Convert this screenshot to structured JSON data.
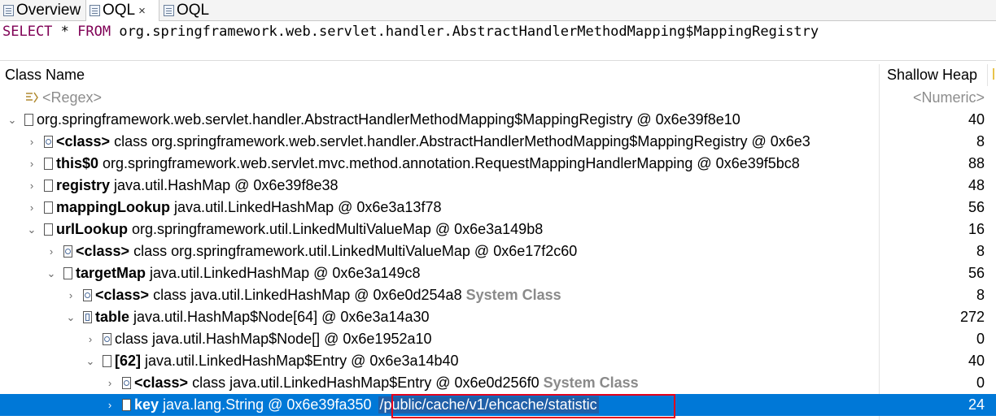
{
  "tabs": [
    {
      "label": "Overview",
      "icon": "overview-icon"
    },
    {
      "label": "OQL",
      "icon": "oql-icon",
      "close": "×"
    },
    {
      "label": "OQL",
      "icon": "oql-icon"
    }
  ],
  "query": {
    "kw1": "SELECT",
    "star": " * ",
    "kw2": "FROM",
    "target": " org.springframework.web.servlet.handler.AbstractHandlerMethodMapping$MappingRegistry"
  },
  "table": {
    "col_class": "Class Name",
    "col_heap": "Shallow Heap",
    "filter_class": "<Regex>",
    "filter_heap": "<Numeric>"
  },
  "rows": [
    {
      "arrow": "⌄",
      "field": "",
      "text": "org.springframework.web.servlet.handler.AbstractHandlerMethodMapping$MappingRegistry @ 0x6e39f8e10",
      "sys": "",
      "heap": "40"
    },
    {
      "arrow": "›",
      "field": "<class>",
      "text": "class org.springframework.web.servlet.handler.AbstractHandlerMethodMapping$MappingRegistry @ 0x6e3",
      "sys": "",
      "heap": "8"
    },
    {
      "arrow": "›",
      "field": "this$0",
      "text": "org.springframework.web.servlet.mvc.method.annotation.RequestMappingHandlerMapping @ 0x6e39f5bc8",
      "sys": "",
      "heap": "88"
    },
    {
      "arrow": "›",
      "field": "registry",
      "text": "java.util.HashMap @ 0x6e39f8e38",
      "sys": "",
      "heap": "48"
    },
    {
      "arrow": "›",
      "field": "mappingLookup",
      "text": "java.util.LinkedHashMap @ 0x6e3a13f78",
      "sys": "",
      "heap": "56"
    },
    {
      "arrow": "⌄",
      "field": "urlLookup",
      "text": "org.springframework.util.LinkedMultiValueMap @ 0x6e3a149b8",
      "sys": "",
      "heap": "16"
    },
    {
      "arrow": "›",
      "field": "<class>",
      "text": "class org.springframework.util.LinkedMultiValueMap @ 0x6e17f2c60",
      "sys": "",
      "heap": "8"
    },
    {
      "arrow": "⌄",
      "field": "targetMap",
      "text": "java.util.LinkedHashMap @ 0x6e3a149c8",
      "sys": "",
      "heap": "56"
    },
    {
      "arrow": "›",
      "field": "<class>",
      "text": "class java.util.LinkedHashMap @ 0x6e0d254a8",
      "sys": "System Class",
      "heap": "8"
    },
    {
      "arrow": "⌄",
      "field": "table",
      "text": "java.util.HashMap$Node[64] @ 0x6e3a14a30",
      "sys": "",
      "heap": "272"
    },
    {
      "arrow": "›",
      "field": "",
      "text": "class java.util.HashMap$Node[] @ 0x6e1952a10",
      "sys": "",
      "heap": "0"
    },
    {
      "arrow": "⌄",
      "field": "[62]",
      "text": "java.util.LinkedHashMap$Entry @ 0x6e3a14b40",
      "sys": "",
      "heap": "40"
    },
    {
      "arrow": "›",
      "field": "<class>",
      "text": "class java.util.LinkedHashMap$Entry @ 0x6e0d256f0",
      "sys": "System Class",
      "heap": "0"
    },
    {
      "arrow": "›",
      "field": "key",
      "text": "java.lang.String @ 0x6e39fa350",
      "value": "/public/cache/v1/ehcache/statistic",
      "sys": "",
      "heap": "24"
    }
  ]
}
